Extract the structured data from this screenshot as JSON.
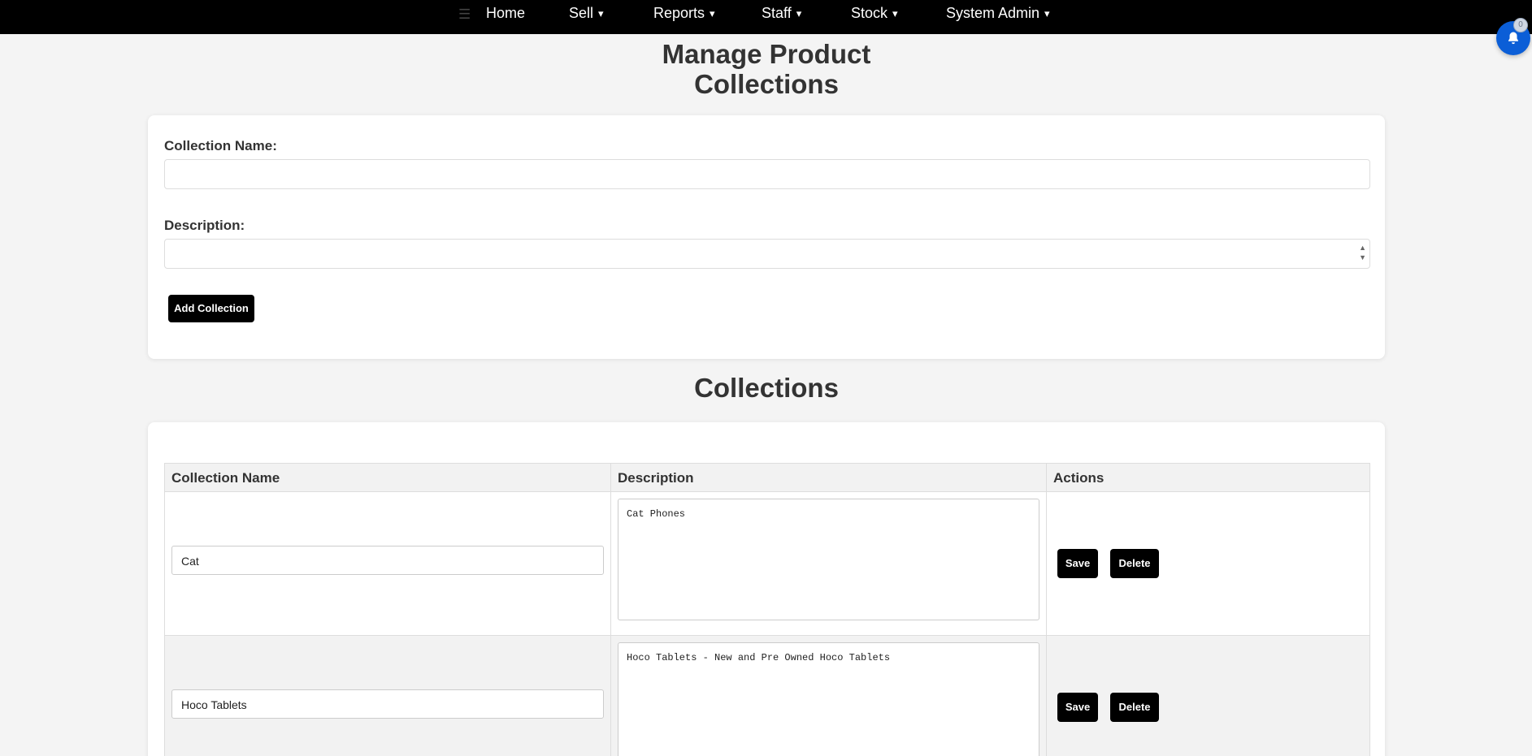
{
  "nav": {
    "menu_icon": "hamburger-icon",
    "items": [
      {
        "label": "Home",
        "caret": ""
      },
      {
        "label": "Sell",
        "caret": "▾"
      },
      {
        "label": "Reports",
        "caret": "▾"
      },
      {
        "label": "Staff",
        "caret": "▾"
      },
      {
        "label": "Stock",
        "caret": "▾"
      },
      {
        "label": "System Admin",
        "caret": "▾"
      }
    ]
  },
  "notification": {
    "icon": "bell-icon",
    "count": "0"
  },
  "page": {
    "title_line1": "Manage Product",
    "title_line2": "Collections"
  },
  "form": {
    "name_label": "Collection Name:",
    "name_value": "",
    "description_label": "Description:",
    "description_value": "",
    "add_button": "Add Collection"
  },
  "collections": {
    "title": "Collections",
    "columns": [
      "Collection Name",
      "Description",
      "Actions"
    ],
    "rows": [
      {
        "name": "Cat",
        "description": "Cat Phones",
        "save": "Save",
        "delete": "Delete"
      },
      {
        "name": "Hoco Tablets",
        "description": "Hoco Tablets - New and Pre Owned Hoco Tablets",
        "save": "Save",
        "delete": "Delete"
      }
    ]
  },
  "colors": {
    "nav_bg": "#000000",
    "accent": "#0b5ed7",
    "button_bg": "#000000",
    "page_bg": "#f4f4f4"
  }
}
